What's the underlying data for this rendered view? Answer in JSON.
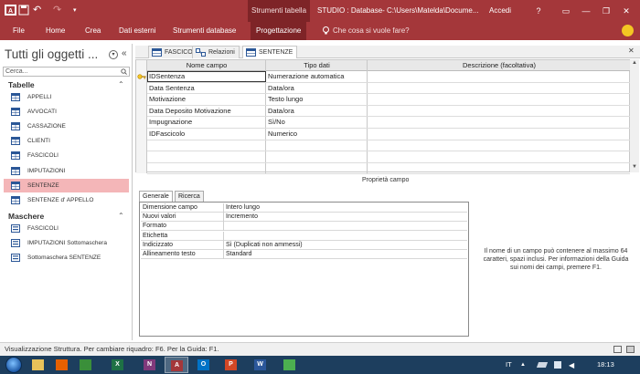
{
  "titlebar": {
    "qat_undo": "↶",
    "qat_redo": "↷",
    "context_tab": "Strumenti tabella",
    "window_title": "STUDIO : Database- C:\\Users\\Matelda\\Docume...",
    "signin": "Accedi",
    "help": "?",
    "controls": {
      "restore_ribbon": "▭",
      "minimize": "—",
      "maximize": "❐",
      "close": "✕"
    }
  },
  "ribbon": {
    "tabs": [
      "File",
      "Home",
      "Crea",
      "Dati esterni",
      "Strumenti database",
      "Progettazione"
    ],
    "search_placeholder": "Che cosa si vuole fare?"
  },
  "nav": {
    "title": "Tutti gli oggetti ...",
    "search_placeholder": "Cerca...",
    "groups": [
      {
        "header": "Tabelle",
        "chevron": "⌃",
        "items": [
          {
            "label": "APPELLI",
            "selected": false
          },
          {
            "label": "AVVOCATI",
            "selected": false
          },
          {
            "label": "CASSAZIONE",
            "selected": false
          },
          {
            "label": "CLIENTI",
            "selected": false
          },
          {
            "label": "FASCICOLI",
            "selected": false
          },
          {
            "label": "IMPUTAZIONI",
            "selected": false
          },
          {
            "label": "SENTENZE",
            "selected": true
          },
          {
            "label": "SENTENZE d' APPELLO",
            "selected": false
          }
        ]
      },
      {
        "header": "Maschere",
        "chevron": "⌃",
        "items": [
          {
            "label": "FASCICOLI",
            "selected": false
          },
          {
            "label": "IMPUTAZIONI Sottomaschera",
            "selected": false
          },
          {
            "label": "Sottomaschera SENTENZE",
            "selected": false
          }
        ]
      }
    ]
  },
  "doc_tabs": [
    {
      "label": "FASCICOLI",
      "active": false
    },
    {
      "label": "Relazioni",
      "active": false
    },
    {
      "label": "SENTENZE",
      "active": true
    }
  ],
  "design_grid": {
    "headers": [
      "Nome campo",
      "Tipo dati",
      "Descrizione (facoltativa)"
    ],
    "rows": [
      {
        "name": "IDSentenza",
        "type": "Numerazione automatica",
        "desc": ""
      },
      {
        "name": "Data Sentenza",
        "type": "Data/ora",
        "desc": ""
      },
      {
        "name": "Motivazione",
        "type": "Testo lungo",
        "desc": ""
      },
      {
        "name": "Data Deposito Motivazione",
        "type": "Data/ora",
        "desc": ""
      },
      {
        "name": "Impugnazione",
        "type": "Sì/No",
        "desc": ""
      },
      {
        "name": "IDFascicolo",
        "type": "Numerico",
        "desc": ""
      }
    ]
  },
  "field_properties": {
    "caption": "Proprietà campo",
    "tabs": [
      "Generale",
      "Ricerca"
    ],
    "rows": [
      {
        "label": "Dimensione campo",
        "value": "Intero lungo"
      },
      {
        "label": "Nuovi valori",
        "value": "Incremento"
      },
      {
        "label": "Formato",
        "value": ""
      },
      {
        "label": "Etichetta",
        "value": ""
      },
      {
        "label": "Indicizzato",
        "value": "Sì (Duplicati non ammessi)"
      },
      {
        "label": "Allineamento testo",
        "value": "Standard"
      }
    ],
    "help": "Il nome di un campo può contenere al massimo 64 caratteri, spazi inclusi. Per informazioni della Guida sui nomi dei campi, premere F1."
  },
  "status": {
    "text": "Visualizzazione Struttura. Per cambiare riquadro: F6. Per la Guida: F1."
  },
  "taskbar": {
    "apps": [
      {
        "name": "explorer",
        "letter": "",
        "color": "#e8c25a",
        "active": false
      },
      {
        "name": "firefox",
        "letter": "",
        "color": "#e66000",
        "active": false
      },
      {
        "name": "media",
        "letter": "",
        "color": "#3a8f3a",
        "active": false
      },
      {
        "name": "excel",
        "letter": "X",
        "color": "#1e7145",
        "active": false
      },
      {
        "name": "onenote",
        "letter": "N",
        "color": "#80397b",
        "active": false
      },
      {
        "name": "access",
        "letter": "A",
        "color": "#a4373a",
        "active": true
      },
      {
        "name": "outlook",
        "letter": "O",
        "color": "#0072c6",
        "active": false
      },
      {
        "name": "powerpoint",
        "letter": "P",
        "color": "#d24726",
        "active": false
      },
      {
        "name": "word",
        "letter": "W",
        "color": "#2b579a",
        "active": false
      },
      {
        "name": "chrome",
        "letter": "",
        "color": "#4caf50",
        "active": false
      }
    ],
    "lang": "IT",
    "time": "18:13"
  },
  "colors": {
    "accent": "#a4373a",
    "accent_dark": "#7e2427",
    "selection": "#f4b6b8",
    "taskbar": "#1d3e5e"
  }
}
